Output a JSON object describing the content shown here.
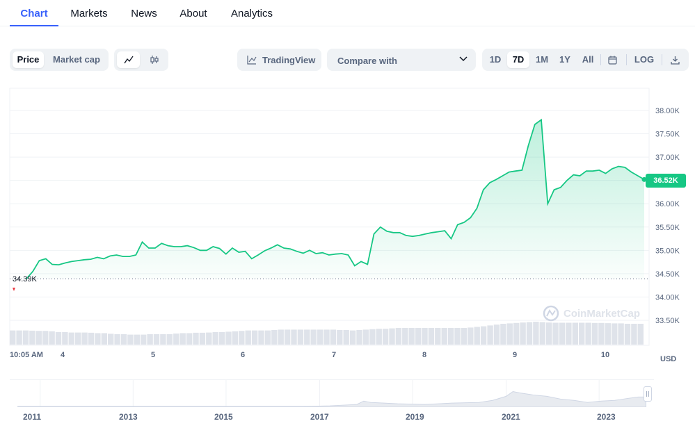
{
  "tabs": [
    {
      "label": "Chart",
      "active": true
    },
    {
      "label": "Markets",
      "active": false
    },
    {
      "label": "News",
      "active": false
    },
    {
      "label": "About",
      "active": false
    },
    {
      "label": "Analytics",
      "active": false
    }
  ],
  "toolbar": {
    "price_label": "Price",
    "market_cap_label": "Market cap",
    "line_icon": "line-chart-icon",
    "candle_icon": "candlestick-icon",
    "tradingview_label": "TradingView",
    "compare_label": "Compare with",
    "ranges": [
      "1D",
      "7D",
      "1M",
      "1Y",
      "All"
    ],
    "selected_range": "7D",
    "calendar_icon": "calendar-icon",
    "log_label": "LOG",
    "download_icon": "download-icon"
  },
  "chart": {
    "current_price_label": "36.52K",
    "open_price_label": "34.39K",
    "currency": "USD",
    "start_time": "10:05 AM",
    "watermark": "CoinMarketCap",
    "colors": {
      "up": "#16c784",
      "down": "#ea3943",
      "volume": "#cfd6e4"
    }
  },
  "chart_data": {
    "type": "area",
    "title": "",
    "xlabel": "",
    "ylabel": "",
    "x_ticks": [
      "10:05 AM",
      "4",
      "5",
      "6",
      "7",
      "8",
      "9",
      "10"
    ],
    "y_ticks": [
      "38.00K",
      "37.50K",
      "37.00K",
      "36.50K",
      "36.00K",
      "35.50K",
      "35.00K",
      "34.50K",
      "34.00K",
      "33.50K"
    ],
    "ylim": [
      33250,
      38200
    ],
    "baseline": 34390,
    "last": 36520,
    "series": [
      {
        "values": [
          34390,
          34550,
          34780,
          34820,
          34700,
          34690,
          34730,
          34760,
          34780,
          34800,
          34810,
          34850,
          34820,
          34880,
          34900,
          34870,
          34870,
          34900,
          35180,
          35050,
          35050,
          35150,
          35100,
          35080,
          35080,
          35100,
          35060,
          35000,
          35000,
          35080,
          35040,
          34920,
          35050,
          34960,
          34980,
          34820,
          34900,
          34990,
          35050,
          35120,
          35050,
          35030,
          34980,
          34940,
          35000,
          34930,
          34950,
          34900,
          34920,
          34930,
          34900,
          34670,
          34760,
          34700,
          35350,
          35500,
          35410,
          35380,
          35380,
          35320,
          35300,
          35320,
          35350,
          35380,
          35400,
          35420,
          35250,
          35550,
          35600,
          35700,
          35900,
          36300,
          36450,
          36520,
          36600,
          36680,
          36700,
          36720,
          37250,
          37700,
          37800,
          36000,
          36300,
          36350,
          36500,
          36620,
          36600,
          36700,
          36700,
          36720,
          36650,
          36750,
          36800,
          36780,
          36680,
          36600,
          36520
        ]
      }
    ],
    "volume": [
      0.68,
      0.68,
      0.68,
      0.67,
      0.66,
      0.66,
      0.64,
      0.6,
      0.6,
      0.58,
      0.58,
      0.58,
      0.57,
      0.55,
      0.55,
      0.52,
      0.5,
      0.5,
      0.48,
      0.48,
      0.48,
      0.5,
      0.5,
      0.5,
      0.5,
      0.53,
      0.55,
      0.55,
      0.57,
      0.57,
      0.58,
      0.6,
      0.6,
      0.62,
      0.64,
      0.66,
      0.68,
      0.68,
      0.68,
      0.68,
      0.7,
      0.72,
      0.72,
      0.72,
      0.72,
      0.72,
      0.72,
      0.72,
      0.72,
      0.72,
      0.7,
      0.7,
      0.68,
      0.7,
      0.72,
      0.74,
      0.76,
      0.76,
      0.78,
      0.8,
      0.8,
      0.8,
      0.8,
      0.8,
      0.8,
      0.8,
      0.8,
      0.8,
      0.8,
      0.8,
      0.82,
      0.85,
      0.88,
      0.92,
      0.96,
      1.0,
      1.02,
      1.04,
      1.06,
      1.08,
      1.1,
      1.08,
      1.06,
      1.05,
      1.05,
      1.05,
      1.05,
      1.05,
      1.05,
      1.04,
      1.04,
      1.03,
      1.02,
      1.02,
      1.0,
      1.0,
      1.0
    ]
  },
  "navigator": {
    "years": [
      "2011",
      "2013",
      "2015",
      "2017",
      "2019",
      "2021",
      "2023"
    ]
  }
}
